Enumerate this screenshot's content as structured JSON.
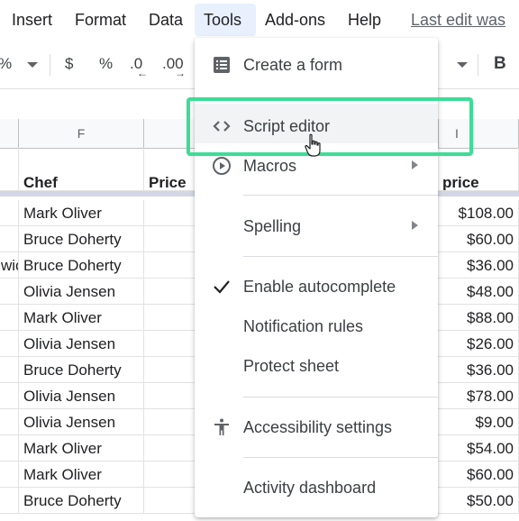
{
  "menubar": {
    "items": [
      {
        "label": "Insert"
      },
      {
        "label": "Format"
      },
      {
        "label": "Data"
      },
      {
        "label": "Tools"
      },
      {
        "label": "Add-ons"
      },
      {
        "label": "Help"
      }
    ],
    "last_edit": "Last edit was"
  },
  "toolbar": {
    "percent_left": "%",
    "currency": "$",
    "percent": "%",
    "decrease_decimals": ".0",
    "increase_decimals": ".00",
    "bold": "B"
  },
  "grid": {
    "columns": [
      "F",
      "I"
    ],
    "headers": {
      "chef": "Chef",
      "price": "Price",
      "i_price": "price"
    },
    "rows": [
      {
        "e": "",
        "chef": "Mark Oliver",
        "price_i": "$108.00"
      },
      {
        "e": "",
        "chef": "Bruce Doherty",
        "price_i": "$60.00"
      },
      {
        "e": "wic",
        "chef": "Bruce Doherty",
        "price_i": "$36.00"
      },
      {
        "e": "",
        "chef": "Olivia Jensen",
        "price_i": "$48.00"
      },
      {
        "e": "",
        "chef": "Mark Oliver",
        "price_i": "$88.00"
      },
      {
        "e": "",
        "chef": "Olivia Jensen",
        "price_i": "$26.00"
      },
      {
        "e": "",
        "chef": "Bruce Doherty",
        "price_i": "$36.00"
      },
      {
        "e": "",
        "chef": "Olivia Jensen",
        "price_i": "$78.00"
      },
      {
        "e": "",
        "chef": "Olivia Jensen",
        "price_i": "$9.00"
      },
      {
        "e": "",
        "chef": "Mark Oliver",
        "price_i": "$54.00"
      },
      {
        "e": "",
        "chef": "Mark Oliver",
        "price_i": "$60.00"
      },
      {
        "e": "",
        "chef": "Bruce Doherty",
        "price_i": "$50.00"
      }
    ]
  },
  "tools_menu": {
    "items": {
      "create_form": "Create a form",
      "script_editor": "Script editor",
      "macros": "Macros",
      "spelling": "Spelling",
      "enable_autocomplete": "Enable autocomplete",
      "notification_rules": "Notification rules",
      "protect_sheet": "Protect sheet",
      "accessibility_settings": "Accessibility settings",
      "activity_dashboard": "Activity dashboard"
    },
    "autocomplete_checked": true
  },
  "colors": {
    "highlight": "#3ddc97",
    "active_menu_bg": "#e8f0fe",
    "hover_bg": "#f1f3f4"
  }
}
